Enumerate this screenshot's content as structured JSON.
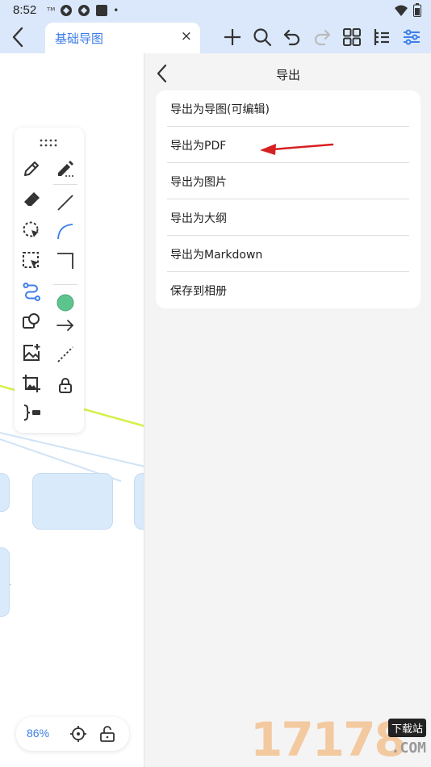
{
  "status_bar": {
    "time": "8:52",
    "carrier_badge": "ᵀᴹ",
    "dot": "•"
  },
  "header": {
    "tab_title": "基础导图",
    "close_glyph": "×",
    "accent_color": "#3d7ee8",
    "toolbar_icons": [
      "plus-icon",
      "search-icon",
      "undo-icon",
      "redo-icon",
      "grid-icon",
      "outline-icon",
      "settings-sliders-icon"
    ]
  },
  "canvas": {
    "zoom": "86%",
    "node_color": "#d9eafb",
    "connector_color": "#d7ef4a"
  },
  "export_panel": {
    "title": "导出",
    "items": [
      {
        "label": "导出为导图(可编辑)"
      },
      {
        "label": "导出为PDF"
      },
      {
        "label": "导出为图片"
      },
      {
        "label": "导出为大纲"
      },
      {
        "label": "导出为Markdown"
      },
      {
        "label": "保存到相册"
      }
    ]
  },
  "watermark": {
    "digits": "17178",
    "badge": "下载站",
    "com": ".COM"
  }
}
